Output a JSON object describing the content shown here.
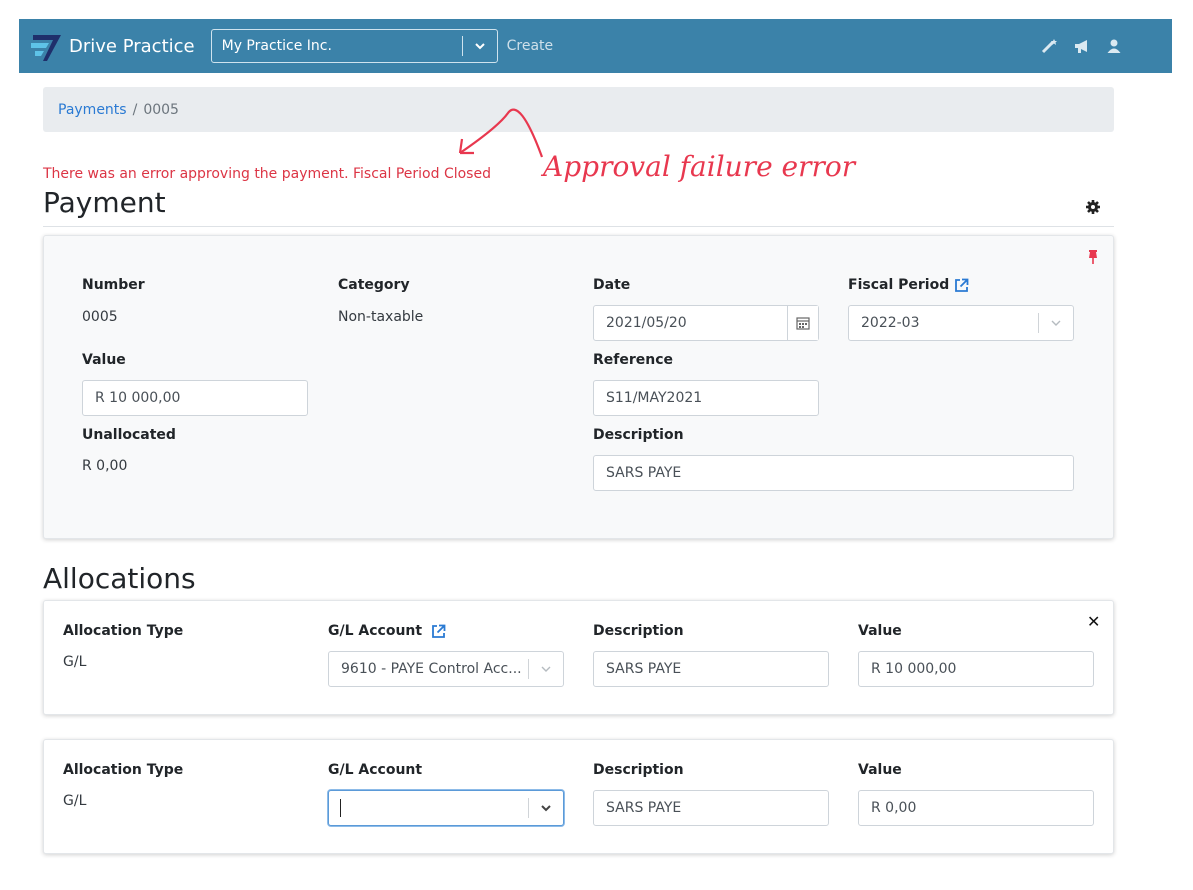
{
  "app": {
    "name": "Drive Practice"
  },
  "navbar": {
    "practice": "My Practice Inc.",
    "create_label": "Create",
    "icons": [
      "magic-wand-icon",
      "megaphone-icon",
      "user-icon"
    ]
  },
  "breadcrumb": {
    "parent": "Payments",
    "separator": "/",
    "current": "0005"
  },
  "error": {
    "message": "There was an error approving the payment. Fiscal Period Closed"
  },
  "annotation": {
    "text": "Approval failure error"
  },
  "payment": {
    "title": "Payment",
    "number_label": "Number",
    "number": "0005",
    "category_label": "Category",
    "category": "Non-taxable",
    "date_label": "Date",
    "date": "2021/05/20",
    "fiscal_label": "Fiscal Period",
    "fiscal": "2022-03",
    "value_label": "Value",
    "value": "R 10 000,00",
    "reference_label": "Reference",
    "reference": "S11/MAY2021",
    "unallocated_label": "Unallocated",
    "unallocated": "R 0,00",
    "description_label": "Description",
    "description": "SARS PAYE"
  },
  "allocations": {
    "title": "Allocations",
    "rows": [
      {
        "type_label": "Allocation Type",
        "type": "G/L",
        "account_label": "G/L Account",
        "account": "9610 - PAYE Control Acc...",
        "desc_label": "Description",
        "description": "SARS PAYE",
        "value_label": "Value",
        "value": "R 10 000,00"
      },
      {
        "type_label": "Allocation Type",
        "type": "G/L",
        "account_label": "G/L Account",
        "account": "",
        "desc_label": "Description",
        "description": "SARS PAYE",
        "value_label": "Value",
        "value": "R 0,00"
      }
    ]
  },
  "colors": {
    "navbar": "#3b82a9",
    "error": "#dc3545",
    "link": "#2a7ad3",
    "annotation": "#e8384f"
  }
}
